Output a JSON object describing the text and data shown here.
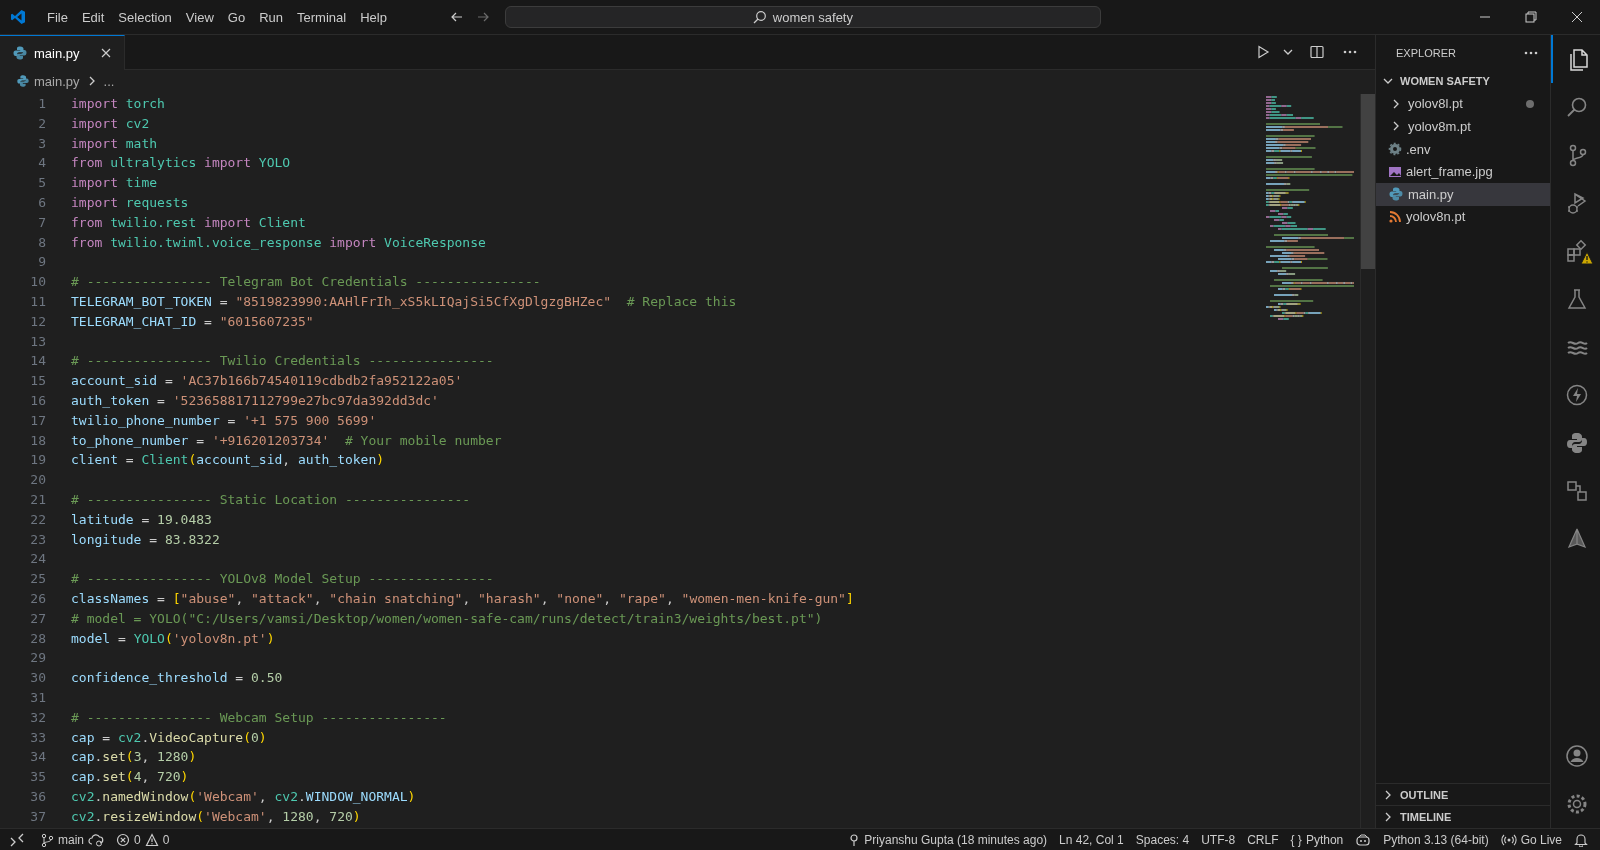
{
  "title_bar": {
    "menu": [
      "File",
      "Edit",
      "Selection",
      "View",
      "Go",
      "Run",
      "Terminal",
      "Help"
    ],
    "search": "women safety"
  },
  "tabs": [
    {
      "label": "main.py",
      "selected": true
    }
  ],
  "breadcrumb": [
    "main.py",
    "..."
  ],
  "editor": {
    "lines": [
      {
        "number": "1",
        "tokens": [
          {
            "kind": "keyword",
            "text": "import"
          },
          {
            "kind": "module",
            "text": " torch"
          }
        ]
      },
      {
        "number": "2",
        "tokens": [
          {
            "kind": "keyword",
            "text": "import"
          },
          {
            "kind": "module",
            "text": " cv2"
          }
        ]
      },
      {
        "number": "3",
        "tokens": [
          {
            "kind": "keyword",
            "text": "import"
          },
          {
            "kind": "module",
            "text": " math"
          }
        ]
      },
      {
        "number": "4",
        "tokens": [
          {
            "kind": "keyword",
            "text": "from"
          },
          {
            "kind": "module",
            "text": " ultralytics "
          },
          {
            "kind": "keyword",
            "text": "import"
          },
          {
            "kind": "module",
            "text": " YOLO"
          }
        ]
      },
      {
        "number": "5",
        "tokens": [
          {
            "kind": "keyword",
            "text": "import"
          },
          {
            "kind": "module",
            "text": " time"
          }
        ]
      },
      {
        "number": "6",
        "tokens": [
          {
            "kind": "keyword",
            "text": "import"
          },
          {
            "kind": "module",
            "text": " requests"
          }
        ]
      },
      {
        "number": "7",
        "tokens": [
          {
            "kind": "keyword",
            "text": "from"
          },
          {
            "kind": "module",
            "text": " twilio.rest "
          },
          {
            "kind": "keyword",
            "text": "import"
          },
          {
            "kind": "module",
            "text": " Client"
          }
        ]
      },
      {
        "number": "8",
        "tokens": [
          {
            "kind": "keyword",
            "text": "from"
          },
          {
            "kind": "module",
            "text": " twilio.twiml.voice_response "
          },
          {
            "kind": "keyword",
            "text": "import"
          },
          {
            "kind": "module",
            "text": " VoiceResponse"
          }
        ]
      },
      {
        "number": "9"
      },
      {
        "number": "10",
        "tokens": [
          {
            "kind": "comment",
            "text": "# ---------------- Telegram Bot Credentials ----------------"
          }
        ]
      },
      {
        "number": "11",
        "tokens": [
          {
            "kind": "variable",
            "text": "TELEGRAM_BOT_TOKEN"
          },
          {
            "kind": "plain",
            "text": " = "
          },
          {
            "kind": "string",
            "text": "\"8519823990:AAHlFrIh_xS5kLIQajSi5CfXgDlgzgBHZec\""
          },
          {
            "kind": "comment",
            "text": "  # Replace this"
          }
        ]
      },
      {
        "number": "12",
        "tokens": [
          {
            "kind": "variable",
            "text": "TELEGRAM_CHAT_ID"
          },
          {
            "kind": "plain",
            "text": " = "
          },
          {
            "kind": "string",
            "text": "\"6015607235\""
          }
        ]
      },
      {
        "number": "13"
      },
      {
        "number": "14",
        "tokens": [
          {
            "kind": "comment",
            "text": "# ---------------- Twilio Credentials ----------------"
          }
        ]
      },
      {
        "number": "15",
        "tokens": [
          {
            "kind": "variable",
            "text": "account_sid"
          },
          {
            "kind": "plain",
            "text": " = "
          },
          {
            "kind": "string",
            "text": "'AC37b166b74540119cdbdb2fa952122a05'"
          }
        ]
      },
      {
        "number": "16",
        "tokens": [
          {
            "kind": "variable",
            "text": "auth_token"
          },
          {
            "kind": "plain",
            "text": " = "
          },
          {
            "kind": "string",
            "text": "'523658817112799e27bc97da392dd3dc'"
          }
        ]
      },
      {
        "number": "17",
        "tokens": [
          {
            "kind": "variable",
            "text": "twilio_phone_number"
          },
          {
            "kind": "plain",
            "text": " = "
          },
          {
            "kind": "string",
            "text": "'+1 575 900 5699'"
          }
        ]
      },
      {
        "number": "18",
        "tokens": [
          {
            "kind": "variable",
            "text": "to_phone_number"
          },
          {
            "kind": "plain",
            "text": " = "
          },
          {
            "kind": "string",
            "text": "'+916201203734'"
          },
          {
            "kind": "comment",
            "text": "  # Your mobile number"
          }
        ]
      },
      {
        "number": "19",
        "tokens": [
          {
            "kind": "variable",
            "text": "client"
          },
          {
            "kind": "plain",
            "text": " = "
          },
          {
            "kind": "module",
            "text": "Client"
          },
          {
            "kind": "bracket",
            "text": "("
          },
          {
            "kind": "variable",
            "text": "account_sid"
          },
          {
            "kind": "plain",
            "text": ", "
          },
          {
            "kind": "variable",
            "text": "auth_token"
          },
          {
            "kind": "bracket",
            "text": ")"
          }
        ]
      },
      {
        "number": "20"
      },
      {
        "number": "21",
        "tokens": [
          {
            "kind": "comment",
            "text": "# ---------------- Static Location ----------------"
          }
        ]
      },
      {
        "number": "22",
        "tokens": [
          {
            "kind": "variable",
            "text": "latitude"
          },
          {
            "kind": "plain",
            "text": " = "
          },
          {
            "kind": "number",
            "text": "19.0483"
          }
        ]
      },
      {
        "number": "23",
        "tokens": [
          {
            "kind": "variable",
            "text": "longitude"
          },
          {
            "kind": "plain",
            "text": " = "
          },
          {
            "kind": "number",
            "text": "83.8322"
          }
        ]
      },
      {
        "number": "24"
      },
      {
        "number": "25",
        "tokens": [
          {
            "kind": "comment",
            "text": "# ---------------- YOLOv8 Model Setup ----------------"
          }
        ]
      },
      {
        "number": "26",
        "tokens": [
          {
            "kind": "variable",
            "text": "classNames"
          },
          {
            "kind": "plain",
            "text": " = "
          },
          {
            "kind": "bracket",
            "text": "["
          },
          {
            "kind": "string",
            "text": "\"abuse\""
          },
          {
            "kind": "plain",
            "text": ", "
          },
          {
            "kind": "string",
            "text": "\"attack\""
          },
          {
            "kind": "plain",
            "text": ", "
          },
          {
            "kind": "string",
            "text": "\"chain snatching\""
          },
          {
            "kind": "plain",
            "text": ", "
          },
          {
            "kind": "string",
            "text": "\"harash\""
          },
          {
            "kind": "plain",
            "text": ", "
          },
          {
            "kind": "string",
            "text": "\"none\""
          },
          {
            "kind": "plain",
            "text": ", "
          },
          {
            "kind": "string",
            "text": "\"rape\""
          },
          {
            "kind": "plain",
            "text": ", "
          },
          {
            "kind": "string",
            "text": "\"women-men-knife-gun\""
          },
          {
            "kind": "bracket",
            "text": "]"
          }
        ]
      },
      {
        "number": "27",
        "tokens": [
          {
            "kind": "comment",
            "text": "# model = YOLO(\"C:/Users/vamsi/Desktop/women/women-safe-cam/runs/detect/train3/weights/best.pt\")"
          }
        ]
      },
      {
        "number": "28",
        "tokens": [
          {
            "kind": "variable",
            "text": "model"
          },
          {
            "kind": "plain",
            "text": " = "
          },
          {
            "kind": "module",
            "text": "YOLO"
          },
          {
            "kind": "bracket",
            "text": "("
          },
          {
            "kind": "string",
            "text": "'yolov8n.pt'"
          },
          {
            "kind": "bracket",
            "text": ")"
          }
        ]
      },
      {
        "number": "29"
      },
      {
        "number": "30",
        "tokens": [
          {
            "kind": "variable",
            "text": "confidence_threshold"
          },
          {
            "kind": "plain",
            "text": " = "
          },
          {
            "kind": "number",
            "text": "0.50"
          }
        ]
      },
      {
        "number": "31"
      },
      {
        "number": "32",
        "tokens": [
          {
            "kind": "comment",
            "text": "# ---------------- Webcam Setup ----------------"
          }
        ]
      },
      {
        "number": "33",
        "tokens": [
          {
            "kind": "variable",
            "text": "cap"
          },
          {
            "kind": "plain",
            "text": " = "
          },
          {
            "kind": "module",
            "text": "cv2"
          },
          {
            "kind": "plain",
            "text": "."
          },
          {
            "kind": "function",
            "text": "VideoCapture"
          },
          {
            "kind": "bracket",
            "text": "("
          },
          {
            "kind": "number",
            "text": "0"
          },
          {
            "kind": "bracket",
            "text": ")"
          }
        ]
      },
      {
        "number": "34",
        "tokens": [
          {
            "kind": "variable",
            "text": "cap"
          },
          {
            "kind": "plain",
            "text": "."
          },
          {
            "kind": "function",
            "text": "set"
          },
          {
            "kind": "bracket",
            "text": "("
          },
          {
            "kind": "number",
            "text": "3"
          },
          {
            "kind": "plain",
            "text": ", "
          },
          {
            "kind": "number",
            "text": "1280"
          },
          {
            "kind": "bracket",
            "text": ")"
          }
        ]
      },
      {
        "number": "35",
        "tokens": [
          {
            "kind": "variable",
            "text": "cap"
          },
          {
            "kind": "plain",
            "text": "."
          },
          {
            "kind": "function",
            "text": "set"
          },
          {
            "kind": "bracket",
            "text": "("
          },
          {
            "kind": "number",
            "text": "4"
          },
          {
            "kind": "plain",
            "text": ", "
          },
          {
            "kind": "number",
            "text": "720"
          },
          {
            "kind": "bracket",
            "text": ")"
          }
        ]
      },
      {
        "number": "36",
        "tokens": [
          {
            "kind": "module",
            "text": "cv2"
          },
          {
            "kind": "plain",
            "text": "."
          },
          {
            "kind": "function",
            "text": "namedWindow"
          },
          {
            "kind": "bracket",
            "text": "("
          },
          {
            "kind": "string",
            "text": "'Webcam'"
          },
          {
            "kind": "plain",
            "text": ", "
          },
          {
            "kind": "module",
            "text": "cv2"
          },
          {
            "kind": "plain",
            "text": "."
          },
          {
            "kind": "variable",
            "text": "WINDOW_NORMAL"
          },
          {
            "kind": "bracket",
            "text": ")"
          }
        ]
      },
      {
        "number": "37",
        "tokens": [
          {
            "kind": "module",
            "text": "cv2"
          },
          {
            "kind": "plain",
            "text": "."
          },
          {
            "kind": "function",
            "text": "resizeWindow"
          },
          {
            "kind": "bracket",
            "text": "("
          },
          {
            "kind": "string",
            "text": "'Webcam'"
          },
          {
            "kind": "plain",
            "text": ", "
          },
          {
            "kind": "number",
            "text": "1280"
          },
          {
            "kind": "plain",
            "text": ", "
          },
          {
            "kind": "number",
            "text": "720"
          },
          {
            "kind": "bracket",
            "text": ")"
          }
        ]
      }
    ]
  },
  "explorer": {
    "title": "EXPLORER",
    "root": {
      "label": "WOMEN SAFETY",
      "expanded": true
    },
    "items": [
      {
        "label": "yolov8l.pt",
        "kind": "folder",
        "expanded": false,
        "modified": true,
        "selected": false
      },
      {
        "label": "yolov8m.pt",
        "kind": "folder",
        "expanded": false,
        "modified": false,
        "selected": false
      },
      {
        "label": ".env",
        "kind": "env",
        "modified": false,
        "selected": false
      },
      {
        "label": "alert_frame.jpg",
        "kind": "image",
        "modified": false,
        "selected": false
      },
      {
        "label": "main.py",
        "kind": "python",
        "modified": false,
        "selected": true
      },
      {
        "label": "yolov8n.pt",
        "kind": "feed",
        "modified": false,
        "selected": false
      }
    ],
    "sections": [
      {
        "label": "OUTLINE",
        "expanded": false
      },
      {
        "label": "TIMELINE",
        "expanded": false
      }
    ]
  },
  "activity_bar": [
    {
      "selected": true,
      "warning": false
    },
    {
      "selected": false,
      "warning": false
    },
    {
      "selected": false,
      "warning": false
    },
    {
      "selected": false,
      "warning": false
    },
    {
      "selected": false,
      "warning": true
    },
    {
      "selected": false,
      "warning": false
    },
    {
      "selected": false,
      "warning": false
    },
    {
      "selected": false,
      "warning": false
    },
    {
      "selected": false,
      "warning": false
    },
    {
      "selected": false,
      "warning": false
    },
    {
      "selected": false,
      "warning": false
    }
  ],
  "status_bar": {
    "branch": "main",
    "errors": "0",
    "warnings": "0",
    "blame": "Priyanshu Gupta (18 minutes ago)",
    "position": "Ln 42, Col 1",
    "indent": "Spaces: 4",
    "encoding": "UTF-8",
    "eol": "CRLF",
    "braces": "{ }",
    "language": "Python",
    "interpreter": "Python 3.13 (64-bit)",
    "live": "Go Live"
  }
}
